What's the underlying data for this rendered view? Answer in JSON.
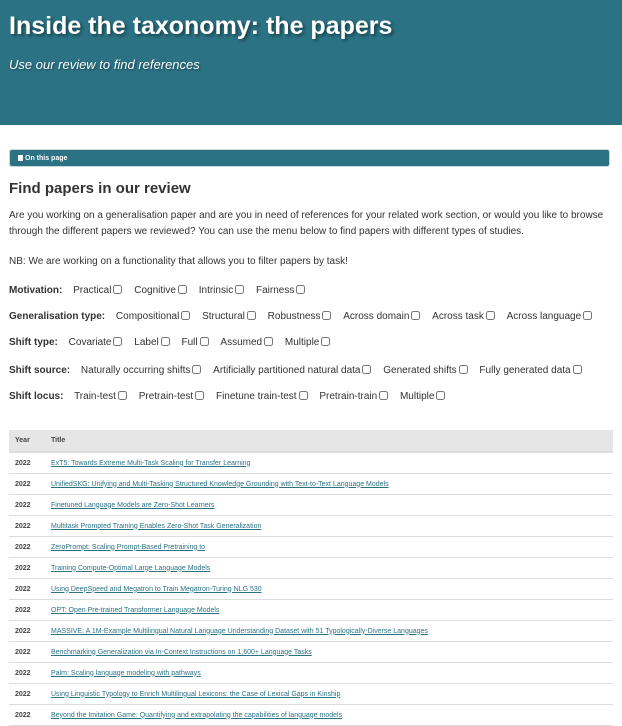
{
  "hero": {
    "title": "Inside the taxonomy: the papers",
    "subtitle": "Use our review to find references"
  },
  "toc": {
    "label": "On this page"
  },
  "section": {
    "heading": "Find papers in our review",
    "intro": "Are you working on a generalisation paper and are you in need of references for your related work section, or would you like to browse through the different papers we reviewed? You can use the menu below to find papers with different types of studies.",
    "note": "NB: We are working on a functionality that allows you to filter papers by task!"
  },
  "filters": [
    {
      "label": "Motivation:",
      "options": [
        "Practical",
        "Cognitive",
        "Intrinsic",
        "Fairness"
      ]
    },
    {
      "label": "Generalisation type:",
      "options": [
        "Compositional",
        "Structural",
        "Robustness",
        "Across domain",
        "Across task",
        "Across language"
      ]
    },
    {
      "label": "Shift type:",
      "options": [
        "Covariate",
        "Label",
        "Full",
        "Assumed",
        "Multiple"
      ]
    },
    {
      "label": "Shift source:",
      "options": [
        "Naturally occurring shifts",
        "Artificially partitioned natural data",
        "Generated shifts",
        "Fully generated data"
      ]
    },
    {
      "label": "Shift locus:",
      "options": [
        "Train-test",
        "Pretrain-test",
        "Finetune train-test",
        "Pretrain-train",
        "Multiple"
      ]
    }
  ],
  "table": {
    "headers": {
      "year": "Year",
      "title": "Title"
    },
    "rows": [
      {
        "year": "2022",
        "title": "ExT5: Towards Extreme Multi-Task Scaling for Transfer Learning"
      },
      {
        "year": "2022",
        "title": "UnifiedSKG: Unifying and Multi-Tasking Structured Knowledge Grounding with Text-to-Text Language Models"
      },
      {
        "year": "2022",
        "title": "Finetuned Language Models are Zero-Shot Learners"
      },
      {
        "year": "2022",
        "title": "Multitask Prompted Training Enables Zero-Shot Task Generalization"
      },
      {
        "year": "2022",
        "title": "ZeroPrompt: Scaling Prompt-Based Pretraining to"
      },
      {
        "year": "2022",
        "title": "Training Compute-Optimal Large Language Models"
      },
      {
        "year": "2022",
        "title": "Using DeepSpeed and Megatron to Train Megatron-Turing NLG 530"
      },
      {
        "year": "2022",
        "title": "OPT: Open Pre-trained Transformer Language Models"
      },
      {
        "year": "2022",
        "title": "MASSIVE: A 1M-Example Multilingual Natural Language Understanding Dataset with 51 Typologically-Diverse Languages"
      },
      {
        "year": "2022",
        "title": "Benchmarking Generalization via In-Context Instructions on 1,600+ Language Tasks"
      },
      {
        "year": "2022",
        "title": "Palm: Scaling language modeling with pathways"
      },
      {
        "year": "2022",
        "title": "Using Linguistic Typology to Enrich Multilingual Lexicons: the Case of Lexical Gaps in Kinship"
      },
      {
        "year": "2022",
        "title": "Beyond the Imitation Game: Quantifying and extrapolating the capabilities of language models"
      }
    ]
  }
}
